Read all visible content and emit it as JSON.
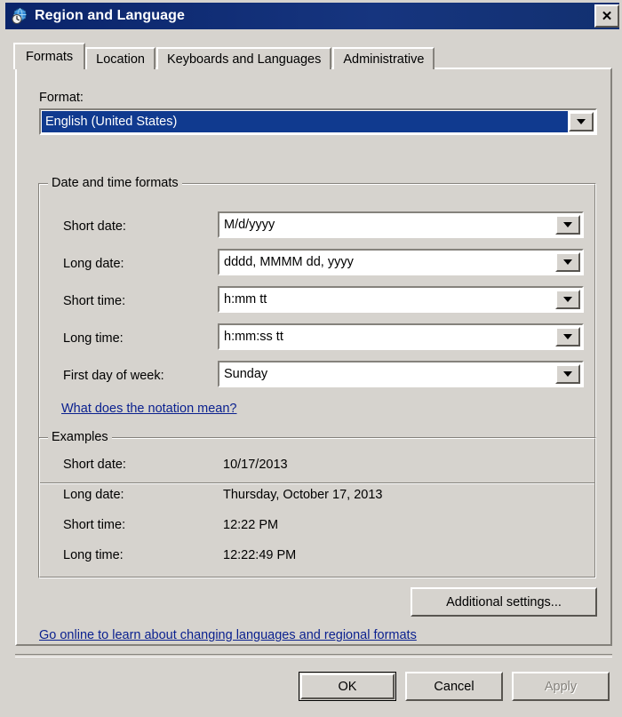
{
  "window": {
    "title": "Region and Language",
    "icon": "globe-clock-icon",
    "close_label": "✕",
    "titlebar_color": "#0a246a",
    "face_color": "#d6d3ce",
    "link_color": "#0b218f",
    "highlight_color": "#103a8f"
  },
  "tabs": [
    {
      "label": "Formats",
      "active": true
    },
    {
      "label": "Location",
      "active": false
    },
    {
      "label": "Keyboards and Languages",
      "active": false
    },
    {
      "label": "Administrative",
      "active": false
    }
  ],
  "format_section": {
    "label": "Format:",
    "selected": "English (United States)"
  },
  "date_time_group": {
    "title": "Date and time formats",
    "rows": [
      {
        "label": "Short date:",
        "value": "M/d/yyyy"
      },
      {
        "label": "Long date:",
        "value": "dddd, MMMM dd, yyyy"
      },
      {
        "label": "Short time:",
        "value": "h:mm tt"
      },
      {
        "label": "Long time:",
        "value": "h:mm:ss tt"
      },
      {
        "label": "First day of week:",
        "value": "Sunday"
      }
    ],
    "notation_link": "What does the notation mean?"
  },
  "examples_group": {
    "title": "Examples",
    "rows": [
      {
        "label": "Short date:",
        "value": "10/17/2013"
      },
      {
        "label": "Long date:",
        "value": "Thursday, October 17, 2013"
      },
      {
        "label": "Short time:",
        "value": "12:22 PM"
      },
      {
        "label": "Long time:",
        "value": "12:22:49 PM"
      }
    ]
  },
  "additional_settings_button": "Additional settings...",
  "online_link": "Go online to learn about changing languages and regional formats",
  "buttons": {
    "ok": "OK",
    "cancel": "Cancel",
    "apply": "Apply"
  }
}
